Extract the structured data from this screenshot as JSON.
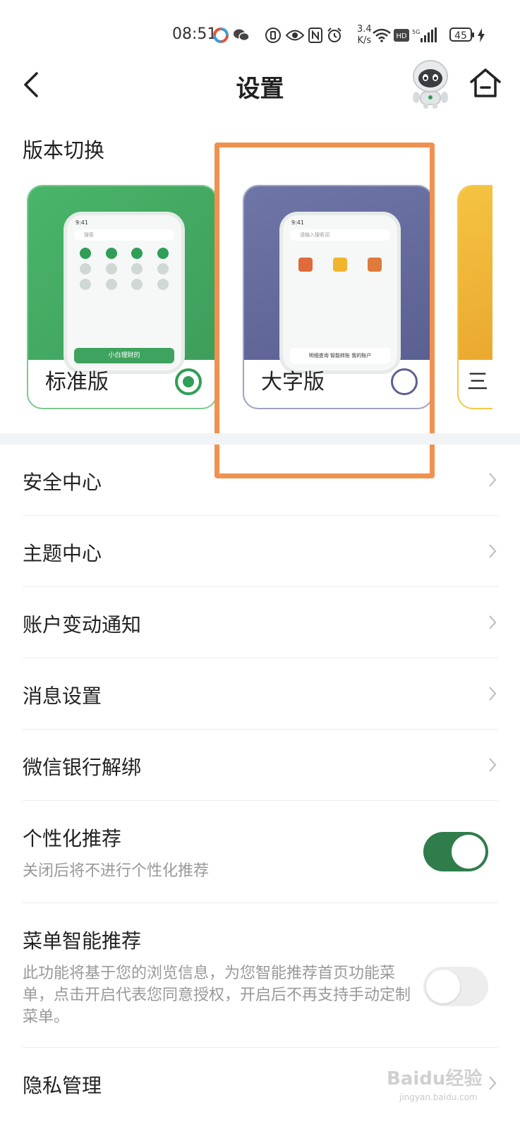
{
  "status_bar": {
    "time": "08:51",
    "speed_value": "3.4",
    "speed_unit": "K/s",
    "battery": "45",
    "icons": [
      "app-icon",
      "wechat-icon",
      "vibrate-icon",
      "eye-icon",
      "nfc-icon",
      "alarm-icon",
      "wifi-icon",
      "hd-icon",
      "signal-5g-icon",
      "battery-icon",
      "charging-icon"
    ]
  },
  "header": {
    "title": "设置",
    "icons": [
      "back-icon",
      "robot-assistant-icon",
      "home-icon"
    ]
  },
  "version_switch": {
    "title": "版本切换",
    "cards": [
      {
        "label": "标准版",
        "selected": true,
        "color": "#49b56a"
      },
      {
        "label": "大字版",
        "selected": false,
        "color": "#6f76a7"
      },
      {
        "label": "三",
        "selected": false,
        "color": "#f5c342"
      }
    ],
    "preview_standard": {
      "time": "9:41",
      "search": "搜索",
      "banner": "小白理财的"
    },
    "preview_large": {
      "time": "9:41",
      "search": "请输入搜索词",
      "banner": "明细查询 智能转账 我的账户"
    },
    "highlight_color": "#ef9150"
  },
  "settings": {
    "items": [
      {
        "label": "安全中心"
      },
      {
        "label": "主题中心"
      },
      {
        "label": "账户变动通知"
      },
      {
        "label": "消息设置"
      },
      {
        "label": "微信银行解绑"
      }
    ],
    "personalized": {
      "label": "个性化推荐",
      "desc": "关闭后将不进行个性化推荐",
      "on": true
    },
    "menu_smart": {
      "label": "菜单智能推荐",
      "desc": "此功能将基于您的浏览信息，为您智能推荐首页功能菜单，点击开启代表您同意授权，开启后不再支持手动定制菜单。",
      "on": false
    },
    "privacy": {
      "label": "隐私管理"
    },
    "toggle_on_color": "#2e7d4a"
  },
  "watermark": {
    "text": "Baidu经验",
    "sub": "jingyan.baidu.com"
  }
}
